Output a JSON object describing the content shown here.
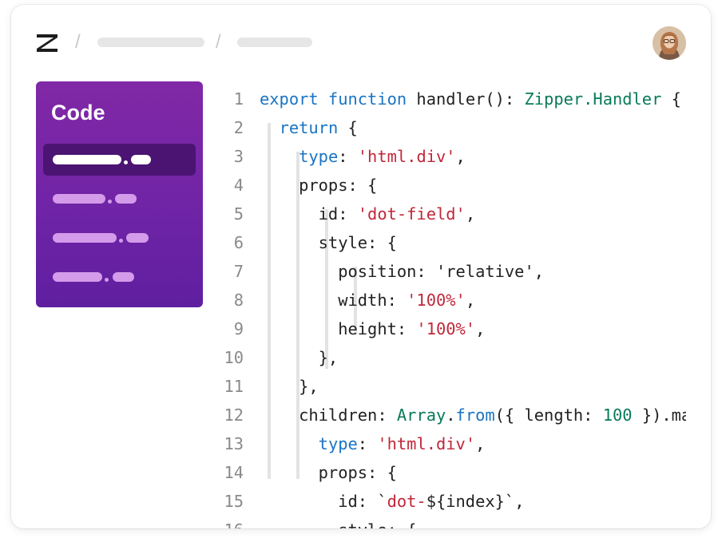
{
  "header": {
    "logo_icon": "zipper-logo-icon",
    "breadcrumb_separator": "/",
    "avatar_icon": "user-avatar"
  },
  "sidebar": {
    "title": "Code",
    "background_colors": [
      "#8128a6",
      "#5f1fa0"
    ],
    "active_item_color": "#4b1472"
  },
  "colors": {
    "keyword": "#1a74c4",
    "type": "#097a5a",
    "string": "#c0283a",
    "number": "#097a5a",
    "text": "#222222",
    "line_number": "#8a8a8a"
  },
  "code": {
    "lines": [
      [
        {
          "t": "export function",
          "c": "keyword"
        },
        {
          "t": " handler(): ",
          "c": "text"
        },
        {
          "t": "Zipper.Handler",
          "c": "type"
        },
        {
          "t": " {",
          "c": "text"
        }
      ],
      [
        {
          "t": "  ",
          "c": "text"
        },
        {
          "t": "return",
          "c": "keyword"
        },
        {
          "t": " {",
          "c": "text"
        }
      ],
      [
        {
          "t": "    ",
          "c": "text"
        },
        {
          "t": "type",
          "c": "keyword"
        },
        {
          "t": ": ",
          "c": "text"
        },
        {
          "t": "'html.div'",
          "c": "string"
        },
        {
          "t": ",",
          "c": "text"
        }
      ],
      [
        {
          "t": "    props: {",
          "c": "text"
        }
      ],
      [
        {
          "t": "      id: ",
          "c": "text"
        },
        {
          "t": "'dot-field'",
          "c": "string"
        },
        {
          "t": ",",
          "c": "text"
        }
      ],
      [
        {
          "t": "      style: {",
          "c": "text"
        }
      ],
      [
        {
          "t": "        position: 'relative',",
          "c": "text"
        }
      ],
      [
        {
          "t": "        width: ",
          "c": "text"
        },
        {
          "t": "'100%'",
          "c": "string"
        },
        {
          "t": ",",
          "c": "text"
        }
      ],
      [
        {
          "t": "        height: ",
          "c": "text"
        },
        {
          "t": "'100%'",
          "c": "string"
        },
        {
          "t": ",",
          "c": "text"
        }
      ],
      [
        {
          "t": "      },",
          "c": "text"
        }
      ],
      [
        {
          "t": "    },",
          "c": "text"
        }
      ],
      [
        {
          "t": "    children: ",
          "c": "text"
        },
        {
          "t": "Array",
          "c": "type"
        },
        {
          "t": ".",
          "c": "text"
        },
        {
          "t": "from",
          "c": "keyword"
        },
        {
          "t": "({ length: ",
          "c": "text"
        },
        {
          "t": "100",
          "c": "number"
        },
        {
          "t": " }).map",
          "c": "text"
        }
      ],
      [
        {
          "t": "      ",
          "c": "text"
        },
        {
          "t": "type",
          "c": "keyword"
        },
        {
          "t": ": ",
          "c": "text"
        },
        {
          "t": "'html.div'",
          "c": "string"
        },
        {
          "t": ",",
          "c": "text"
        }
      ],
      [
        {
          "t": "      props: {",
          "c": "text"
        }
      ],
      [
        {
          "t": "        id: `",
          "c": "text"
        },
        {
          "t": "dot-",
          "c": "string"
        },
        {
          "t": "${index}`,",
          "c": "text"
        }
      ],
      [
        {
          "t": "        style: {",
          "c": "text"
        }
      ]
    ]
  }
}
